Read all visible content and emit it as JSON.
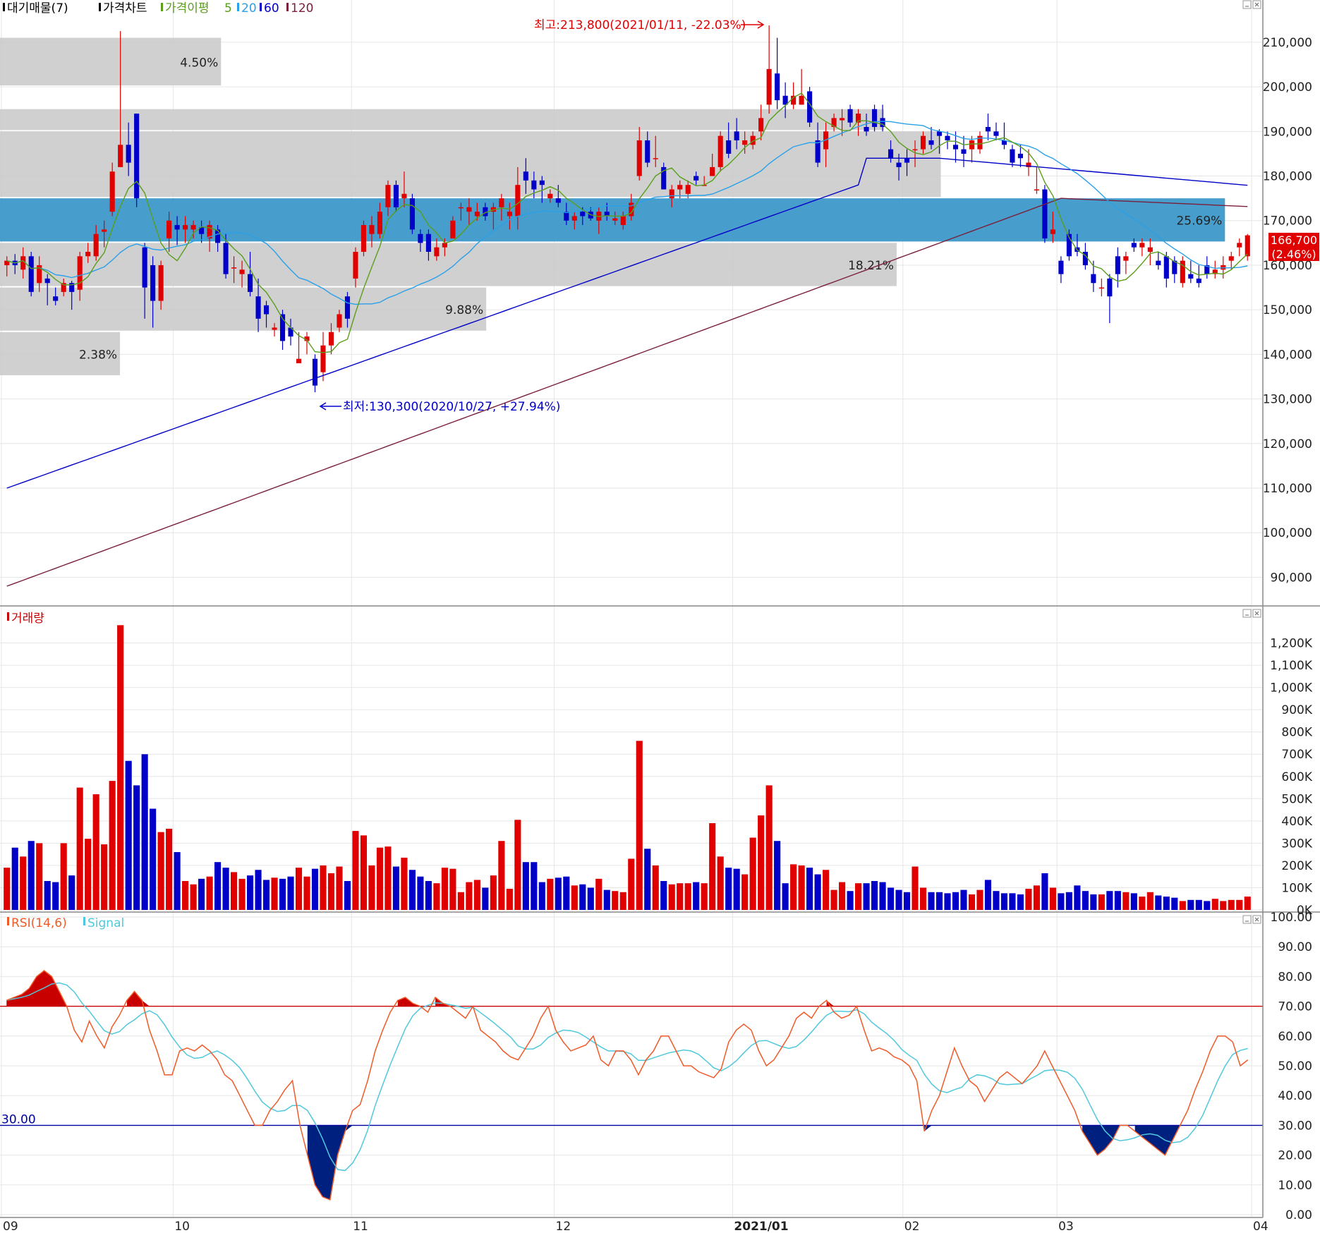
{
  "colors": {
    "up": "#e00000",
    "down": "#0000c8",
    "ma5": "#5a9e1c",
    "ma20": "#2aa0e8",
    "ma60": "#0000c8",
    "ma120": "#7a1e3a",
    "band_gray": "#c8c8c8",
    "band_blue": "#3d98c8",
    "grid": "#e6e6e6",
    "rsi": "#f05a28",
    "signal": "#50c8dc",
    "rsi_fill_high": "#c80000",
    "rsi_fill_low": "#002080",
    "line70": "#c80000",
    "line30": "#0000a0"
  },
  "price_panel": {
    "legend": [
      "대기매물(7)",
      "가격차트",
      "가격이평",
      "5",
      "20",
      "60",
      "120"
    ],
    "y_ticks": [
      "210,000",
      "200,000",
      "190,000",
      "180,000",
      "170,000",
      "160,000",
      "150,000",
      "140,000",
      "130,000",
      "120,000",
      "110,000",
      "100,000",
      "90,000"
    ],
    "current_price": "166,700",
    "current_change": "(2.46%)",
    "high_annotation": "최고:213,800(2021/01/11, -22.03%)",
    "low_annotation": "최저:130,300(2020/10/27, +27.94%)"
  },
  "volume_panel": {
    "legend": "거래량",
    "y_ticks": [
      "1,200K",
      "1,100K",
      "1,000K",
      "900K",
      "800K",
      "700K",
      "600K",
      "500K",
      "400K",
      "300K",
      "200K",
      "100K",
      "0K"
    ]
  },
  "rsi_panel": {
    "legend_rsi": "RSI(14,6)",
    "legend_signal": "Signal",
    "y_ticks": [
      "100.00",
      "90.00",
      "80.00",
      "70.00",
      "60.00",
      "50.00",
      "40.00",
      "30.00",
      "20.00",
      "10.00",
      "0.00"
    ],
    "level_label": "30.00"
  },
  "x_axis": {
    "labels": [
      "09",
      "10",
      "11",
      "12",
      "2021/01",
      "02",
      "03",
      "04"
    ]
  },
  "chart_data": {
    "type": "candlestick",
    "price_range": [
      85000,
      216000
    ],
    "volume_range": [
      0,
      1300000
    ],
    "rsi_range": [
      0,
      100
    ],
    "supply_bands": [
      {
        "label": "4.50%",
        "low": 200000,
        "high": 211000,
        "ratio": 4.5
      },
      {
        "label": "",
        "low": 190000,
        "high": 195000,
        "ratio": null
      },
      {
        "label": "",
        "low": 175000,
        "high": 190000,
        "ratio": null
      },
      {
        "label": "25.69%",
        "low": 165000,
        "high": 175000,
        "ratio": 25.69,
        "highlight": true
      },
      {
        "label": "18.21%",
        "low": 155000,
        "high": 165000,
        "ratio": 18.21
      },
      {
        "label": "9.88%",
        "low": 145000,
        "high": 155000,
        "ratio": 9.88
      },
      {
        "label": "2.38%",
        "low": 135000,
        "high": 145000,
        "ratio": 2.38
      }
    ],
    "candles": [
      [
        160000,
        162000,
        157500,
        161000,
        190000
      ],
      [
        161000,
        162500,
        158000,
        160000,
        280000
      ],
      [
        159000,
        164000,
        157000,
        162000,
        240000
      ],
      [
        162000,
        163000,
        153000,
        154000,
        310000
      ],
      [
        156000,
        162000,
        154000,
        160000,
        300000
      ],
      [
        157000,
        158000,
        151000,
        156000,
        130000
      ],
      [
        153000,
        155000,
        151000,
        152000,
        125000
      ],
      [
        154000,
        157000,
        153000,
        156000,
        300000
      ],
      [
        156000,
        156500,
        150000,
        154000,
        155000
      ],
      [
        154500,
        163000,
        152000,
        162000,
        550000
      ],
      [
        162000,
        165000,
        160500,
        163000,
        320000
      ],
      [
        162000,
        169000,
        161000,
        167000,
        520000
      ],
      [
        167500,
        170000,
        164000,
        168000,
        295000
      ],
      [
        172000,
        183000,
        171000,
        181000,
        580000
      ],
      [
        182000,
        212500,
        182000,
        187000,
        1280000
      ],
      [
        187000,
        192000,
        180000,
        183000,
        670000
      ],
      [
        194000,
        194000,
        173000,
        175000,
        560000
      ],
      [
        164000,
        165000,
        148000,
        155000,
        700000
      ],
      [
        160000,
        162000,
        146000,
        152000,
        455000
      ],
      [
        152000,
        161000,
        150000,
        160000,
        350000
      ],
      [
        166000,
        172000,
        163000,
        170000,
        365000
      ],
      [
        169000,
        171000,
        164500,
        168000,
        260000
      ],
      [
        168000,
        171000,
        165000,
        169000,
        130000
      ],
      [
        168000,
        170000,
        166000,
        169000,
        115000
      ],
      [
        168500,
        170000,
        165000,
        167000,
        140000
      ],
      [
        166000,
        170000,
        163000,
        169000,
        150000
      ],
      [
        168000,
        169000,
        163000,
        165000,
        215000
      ],
      [
        165000,
        167000,
        157000,
        158000,
        190000
      ],
      [
        159500,
        162000,
        156000,
        159500,
        170000
      ],
      [
        158000,
        161000,
        155000,
        159000,
        140000
      ],
      [
        158000,
        163000,
        153000,
        154000,
        155000
      ],
      [
        153000,
        157000,
        145000,
        148000,
        180000
      ],
      [
        151000,
        152000,
        146000,
        149000,
        135000
      ],
      [
        145500,
        147000,
        144000,
        146000,
        145000
      ],
      [
        149000,
        150000,
        141000,
        143000,
        140000
      ],
      [
        146000,
        148000,
        142000,
        144000,
        150000
      ],
      [
        138000,
        145000,
        138000,
        139000,
        190000
      ],
      [
        143000,
        145000,
        140000,
        144000,
        150000
      ],
      [
        139000,
        140000,
        131500,
        133000,
        185000
      ],
      [
        136000,
        145000,
        134000,
        142000,
        200000
      ],
      [
        142000,
        147000,
        140000,
        145000,
        165000
      ],
      [
        146000,
        150000,
        145000,
        149000,
        195000
      ],
      [
        153000,
        154000,
        146000,
        148000,
        130000
      ],
      [
        157000,
        164000,
        155000,
        163000,
        355000
      ],
      [
        163000,
        170000,
        162000,
        169000,
        335000
      ],
      [
        167000,
        171000,
        164000,
        169000,
        200000
      ],
      [
        167000,
        174000,
        166000,
        172000,
        280000
      ],
      [
        173000,
        179000,
        171000,
        178000,
        285000
      ],
      [
        178000,
        179000,
        172000,
        173000,
        195000
      ],
      [
        175000,
        181000,
        173000,
        176000,
        235000
      ],
      [
        175000,
        176000,
        167000,
        168000,
        180000
      ],
      [
        167000,
        168000,
        163000,
        165000,
        150000
      ],
      [
        167000,
        168000,
        161000,
        163000,
        130000
      ],
      [
        162000,
        166000,
        161000,
        164000,
        120000
      ],
      [
        164000,
        166000,
        162000,
        165000,
        190000
      ],
      [
        166000,
        171000,
        166000,
        170000,
        185000
      ],
      [
        173000,
        174000,
        170000,
        173000,
        80000
      ],
      [
        172000,
        175000,
        169000,
        173000,
        125000
      ],
      [
        171000,
        174000,
        170000,
        172000,
        135000
      ],
      [
        173000,
        174000,
        170000,
        171000,
        100000
      ],
      [
        172000,
        174000,
        168000,
        173000,
        155000
      ],
      [
        173000,
        176000,
        170000,
        175000,
        310000
      ],
      [
        171000,
        174000,
        168000,
        172000,
        95000
      ],
      [
        171000,
        182000,
        168000,
        178000,
        405000
      ],
      [
        181000,
        184000,
        176000,
        179000,
        215000
      ],
      [
        179000,
        181000,
        175000,
        177000,
        215000
      ],
      [
        179000,
        180000,
        174000,
        178000,
        125000
      ],
      [
        175000,
        177000,
        174000,
        176000,
        140000
      ],
      [
        175000,
        178000,
        173000,
        174000,
        145000
      ],
      [
        172000,
        174000,
        169000,
        170000,
        150000
      ],
      [
        170000,
        172000,
        168000,
        171000,
        110000
      ],
      [
        172000,
        173000,
        169000,
        171000,
        115000
      ],
      [
        172000,
        173000,
        170000,
        170500,
        100000
      ],
      [
        170000,
        173000,
        167000,
        172000,
        140000
      ],
      [
        172000,
        174000,
        170000,
        171000,
        90000
      ],
      [
        170000,
        172000,
        169000,
        170500,
        85000
      ],
      [
        169000,
        172000,
        168000,
        171000,
        80000
      ],
      [
        171000,
        176000,
        170000,
        174000,
        230000
      ],
      [
        180000,
        191000,
        179000,
        188000,
        760000
      ],
      [
        188000,
        190000,
        182000,
        183000,
        275000
      ],
      [
        184000,
        189000,
        182000,
        184000,
        200000
      ],
      [
        182000,
        183000,
        177000,
        177000,
        130000
      ],
      [
        175000,
        178000,
        173000,
        177000,
        115000
      ],
      [
        177000,
        179000,
        175000,
        178000,
        120000
      ],
      [
        176000,
        179000,
        175000,
        178000,
        120000
      ],
      [
        180000,
        181000,
        178000,
        179000,
        125000
      ],
      [
        178000,
        180000,
        178000,
        178000,
        120000
      ],
      [
        180000,
        185000,
        180000,
        182000,
        390000
      ],
      [
        182000,
        190000,
        181000,
        189000,
        240000
      ],
      [
        188000,
        192000,
        184000,
        185000,
        190000
      ],
      [
        190000,
        193000,
        186000,
        188000,
        185000
      ],
      [
        187000,
        190000,
        185000,
        188000,
        160000
      ],
      [
        187000,
        190000,
        186000,
        189000,
        325000
      ],
      [
        190000,
        196000,
        188000,
        193000,
        425000
      ],
      [
        196000,
        213800,
        194000,
        204000,
        560000
      ],
      [
        203000,
        211000,
        195000,
        197000,
        310000
      ],
      [
        198000,
        201000,
        193000,
        196000,
        120000
      ],
      [
        196000,
        201000,
        195000,
        198000,
        205000
      ],
      [
        196000,
        204000,
        196000,
        198000,
        200000
      ],
      [
        199000,
        200000,
        191000,
        192000,
        190000
      ],
      [
        188000,
        192000,
        182000,
        183000,
        160000
      ],
      [
        186000,
        192000,
        182000,
        190000,
        180000
      ],
      [
        191000,
        194000,
        190000,
        193000,
        90000
      ],
      [
        192500,
        195000,
        189000,
        193000,
        125000
      ],
      [
        195000,
        196000,
        191000,
        192000,
        85000
      ],
      [
        192000,
        195000,
        189000,
        194000,
        120000
      ],
      [
        191000,
        194000,
        189000,
        190000,
        120000
      ],
      [
        195000,
        196000,
        190000,
        191000,
        130000
      ],
      [
        193000,
        196000,
        190000,
        191000,
        125000
      ],
      [
        186000,
        188000,
        183000,
        184000,
        100000
      ],
      [
        183000,
        185000,
        179000,
        182000,
        90000
      ],
      [
        184000,
        186000,
        180000,
        183000,
        80000
      ],
      [
        186000,
        188000,
        182000,
        186000,
        195000
      ],
      [
        186000,
        190000,
        185000,
        189000,
        100000
      ],
      [
        188000,
        191000,
        186000,
        187000,
        80000
      ],
      [
        190000,
        190500,
        185000,
        189000,
        80000
      ],
      [
        189000,
        190000,
        186000,
        188000,
        75000
      ],
      [
        187000,
        190000,
        183000,
        186000,
        80000
      ],
      [
        186000,
        189000,
        182000,
        185000,
        90000
      ],
      [
        186000,
        189000,
        183000,
        188000,
        70000
      ],
      [
        186000,
        190000,
        185000,
        189000,
        90000
      ],
      [
        191000,
        194000,
        188000,
        190000,
        135000
      ],
      [
        190000,
        192000,
        188000,
        189000,
        85000
      ],
      [
        188000,
        192000,
        186000,
        187000,
        75000
      ],
      [
        186000,
        187000,
        182000,
        183000,
        75000
      ],
      [
        185000,
        187000,
        182000,
        184000,
        70000
      ],
      [
        182000,
        186000,
        180000,
        183000,
        95000
      ],
      [
        177000,
        182000,
        176000,
        177000,
        110000
      ],
      [
        177000,
        178000,
        165000,
        166000,
        165000
      ],
      [
        167000,
        172000,
        165000,
        168000,
        100000
      ],
      [
        161000,
        162000,
        156000,
        158000,
        75000
      ],
      [
        167000,
        168000,
        161000,
        162000,
        80000
      ],
      [
        164000,
        167000,
        162000,
        163000,
        110000
      ],
      [
        163000,
        165000,
        159000,
        160000,
        85000
      ],
      [
        158000,
        161000,
        154000,
        156000,
        70000
      ],
      [
        155000,
        157000,
        153000,
        155000,
        70000
      ],
      [
        157000,
        158000,
        147000,
        153000,
        85000
      ],
      [
        162000,
        164000,
        155000,
        158000,
        85000
      ],
      [
        161000,
        163000,
        158000,
        162000,
        80000
      ],
      [
        165000,
        166000,
        163000,
        164000,
        75000
      ],
      [
        164000,
        166000,
        162000,
        165000,
        60000
      ],
      [
        163000,
        166000,
        160000,
        164000,
        80000
      ],
      [
        161000,
        163000,
        159000,
        160000,
        65000
      ],
      [
        162000,
        163000,
        155000,
        157000,
        60000
      ],
      [
        161000,
        162000,
        156000,
        158000,
        55000
      ],
      [
        156000,
        162000,
        155000,
        161000,
        40000
      ],
      [
        158000,
        161000,
        156000,
        157000,
        45000
      ],
      [
        157000,
        160000,
        155000,
        156000,
        45000
      ],
      [
        160000,
        162000,
        157000,
        158000,
        40000
      ],
      [
        158000,
        161000,
        157000,
        159000,
        50000
      ],
      [
        159000,
        162000,
        157000,
        160000,
        40000
      ],
      [
        161000,
        163000,
        159000,
        162000,
        45000
      ],
      [
        164000,
        166000,
        162000,
        165000,
        45000
      ],
      [
        162000,
        167000,
        161000,
        166700,
        60000
      ]
    ],
    "ma_series_days": [
      5,
      20,
      60,
      120
    ],
    "rsi_values": [
      72,
      73,
      74,
      76,
      80,
      82,
      80,
      75,
      70,
      62,
      58,
      65,
      60,
      56,
      63,
      67,
      72,
      75,
      72,
      62,
      55,
      47,
      47,
      55,
      56,
      55,
      57,
      55,
      52,
      47,
      45,
      40,
      35,
      30,
      30,
      35,
      38,
      42,
      45,
      30,
      20,
      10,
      6,
      5,
      20,
      28,
      35,
      37,
      45,
      55,
      62,
      68,
      72,
      73,
      71,
      70,
      68,
      73,
      71,
      70,
      68,
      66,
      70,
      62,
      60,
      58,
      55,
      53,
      52,
      56,
      60,
      66,
      70,
      62,
      58,
      55,
      56,
      57,
      60,
      52,
      50,
      55,
      55,
      52,
      47,
      52,
      55,
      60,
      60,
      55,
      50,
      50,
      48,
      47,
      46,
      49,
      58,
      62,
      64,
      62,
      55,
      50,
      52,
      56,
      60,
      66,
      68,
      66,
      70,
      72,
      68,
      66,
      67,
      70,
      62,
      55,
      56,
      55,
      53,
      52,
      50,
      45,
      28,
      35,
      40,
      48,
      56,
      50,
      45,
      43,
      38,
      42,
      46,
      48,
      46,
      44,
      47,
      50,
      55,
      50,
      45,
      40,
      35,
      28,
      24,
      20,
      22,
      25,
      30,
      30,
      28,
      26,
      24,
      22,
      20,
      25,
      30,
      35,
      42,
      48,
      55,
      60,
      60,
      58,
      50,
      52
    ]
  }
}
